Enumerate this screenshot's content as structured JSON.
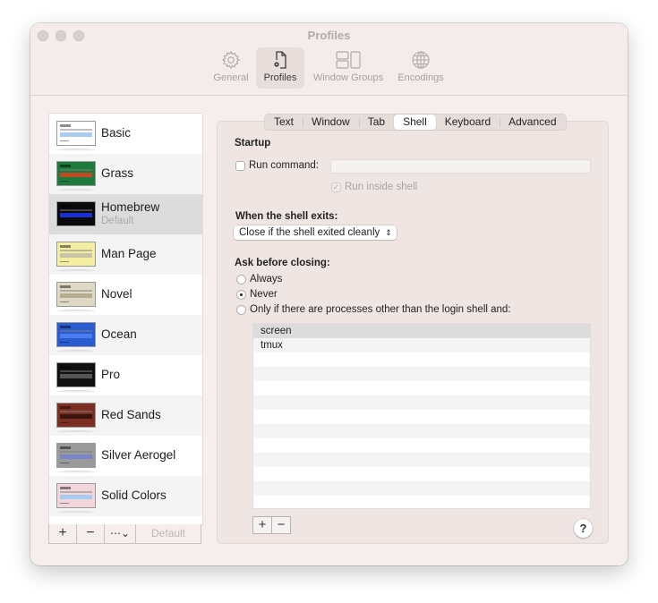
{
  "window": {
    "title": "Profiles"
  },
  "toolbar": {
    "items": [
      {
        "label": "General",
        "icon": "gear-icon",
        "selected": false
      },
      {
        "label": "Profiles",
        "icon": "profile-document-icon",
        "selected": true
      },
      {
        "label": "Window Groups",
        "icon": "window-groups-icon",
        "selected": false
      },
      {
        "label": "Encodings",
        "icon": "globe-icon",
        "selected": false
      }
    ]
  },
  "profiles": {
    "items": [
      {
        "name": "Basic",
        "bg": "#ffffff",
        "band": "#a9cdf2"
      },
      {
        "name": "Grass",
        "bg": "#1f7a3d",
        "band": "#c04a23"
      },
      {
        "name": "Homebrew",
        "subtitle": "Default",
        "bg": "#0a0a0a",
        "band": "#1a2fcf",
        "selected": true
      },
      {
        "name": "Man Page",
        "bg": "#f3eea2",
        "band": "#c9c4a8"
      },
      {
        "name": "Novel",
        "bg": "#ddd9c4",
        "band": "#b6ad8e"
      },
      {
        "name": "Ocean",
        "bg": "#2a5bd1",
        "band": "#4a7ef0"
      },
      {
        "name": "Pro",
        "bg": "#111111",
        "band": "#555555"
      },
      {
        "name": "Red Sands",
        "bg": "#7a2f22",
        "band": "#3a1410"
      },
      {
        "name": "Silver Aerogel",
        "bg": "#9a9a9a",
        "band": "#7b84c8"
      },
      {
        "name": "Solid Colors",
        "bg": "#f3d6dc",
        "band": "#a8ccf0"
      }
    ],
    "bar": {
      "add": "+",
      "remove": "−",
      "more": "⋯⌄",
      "default_label": "Default"
    }
  },
  "tabs": [
    {
      "label": "Text",
      "selected": false
    },
    {
      "label": "Window",
      "selected": false
    },
    {
      "label": "Tab",
      "selected": false
    },
    {
      "label": "Shell",
      "selected": true
    },
    {
      "label": "Keyboard",
      "selected": false
    },
    {
      "label": "Advanced",
      "selected": false
    }
  ],
  "shell": {
    "startup_heading": "Startup",
    "run_command_label": "Run command:",
    "run_command_checked": false,
    "run_command_value": "",
    "run_inside_shell_label": "Run inside shell",
    "run_inside_shell_checked": true,
    "exit_heading": "When the shell exits:",
    "exit_option": "Close if the shell exited cleanly",
    "ask_heading": "Ask before closing:",
    "ask_options": [
      {
        "label": "Always",
        "selected": false
      },
      {
        "label": "Never",
        "selected": true
      },
      {
        "label": "Only if there are processes other than the login shell and:",
        "selected": false
      }
    ],
    "processes": [
      "screen",
      "tmux"
    ],
    "add_label": "+",
    "remove_label": "−",
    "help_label": "?"
  }
}
